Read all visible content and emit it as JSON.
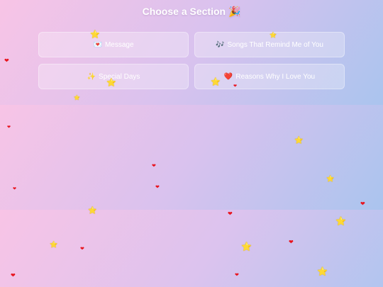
{
  "title": "Choose a Section 🎉",
  "sections": [
    {
      "emoji": "💌",
      "label": "Message"
    },
    {
      "emoji": "🎶",
      "label": "Songs That Remind Me of You"
    },
    {
      "emoji": "✨",
      "label": "Special Days"
    },
    {
      "emoji": "❤️",
      "label": "Reasons Why I Love You"
    }
  ],
  "decor": {
    "heart_glyph": "❤",
    "star_glyph": "⭐",
    "heart_color": "#e8141e",
    "star_color": "#f2c230"
  }
}
